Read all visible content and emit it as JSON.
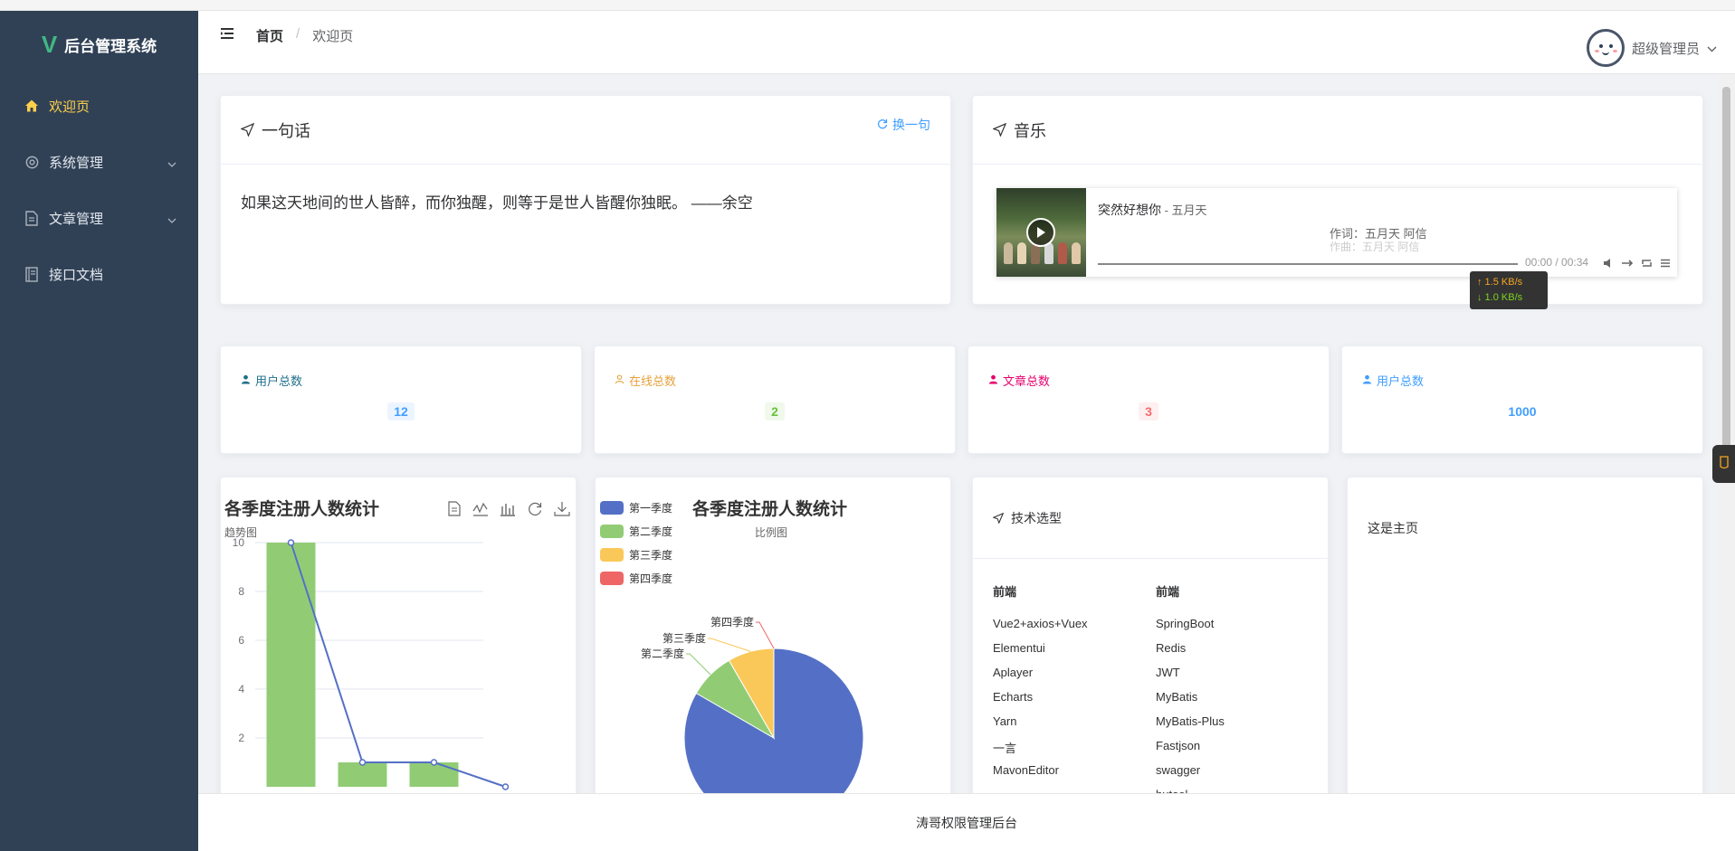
{
  "sidebar": {
    "logo": "V",
    "title": "后台管理系统",
    "items": [
      {
        "label": "欢迎页",
        "icon": "home-icon"
      },
      {
        "label": "系统管理",
        "icon": "gear-icon"
      },
      {
        "label": "文章管理",
        "icon": "document-icon"
      },
      {
        "label": "接口文档",
        "icon": "notebook-icon"
      }
    ]
  },
  "header": {
    "breadcrumb": [
      "首页",
      "欢迎页"
    ],
    "separator": "/",
    "user_name": "超级管理员"
  },
  "quote_card": {
    "title": "一句话",
    "refresh_label": "换一句",
    "text": "如果这天地间的世人皆醉，而你独醒，则等于是世人皆醒你独眠。 ——余空"
  },
  "music_card": {
    "title": "音乐",
    "song": "突然好想你",
    "artist": " - 五月天",
    "lyric_line1": "作词：五月天 阿信",
    "lyric_line2": "作曲：五月天 阿信",
    "time": "00:00 / 00:34",
    "upload_speed": "↑ 1.5 KB/s",
    "download_speed": "↓ 1.0 KB/s"
  },
  "stats": [
    {
      "label": "用户总数",
      "value": "12",
      "color": "#409eff",
      "bg": "#ecf5ff"
    },
    {
      "label": "在线总数",
      "value": "2",
      "color": "#67c23a",
      "bg": "#f0f9eb"
    },
    {
      "label": "文章总数",
      "value": "3",
      "color": "#f56c6c",
      "bg": "#fef0f0"
    },
    {
      "label": "用户总数",
      "value": "1000",
      "color": "#409eff",
      "bg": "transparent"
    }
  ],
  "stat_label_colors": [
    "#1f6f8b",
    "#e6a23c",
    "#e6006d",
    "#409eff"
  ],
  "chart_data": [
    {
      "type": "bar",
      "title": "各季度注册人数统计",
      "subtitle": "趋势图",
      "ylim": [
        0,
        10
      ],
      "yticks": [
        2,
        4,
        6,
        8,
        10
      ],
      "values": [
        10,
        1,
        1,
        0
      ],
      "line_values": [
        10,
        1,
        1,
        0
      ],
      "bar_color": "#91cc75",
      "line_color": "#5470c6",
      "toolbox": [
        "dataview-icon",
        "line-icon",
        "bar-icon",
        "restore-icon",
        "download-icon"
      ]
    },
    {
      "type": "pie",
      "title": "各季度注册人数统计",
      "subtitle": "比例图",
      "categories": [
        "第一季度",
        "第二季度",
        "第三季度",
        "第四季度"
      ],
      "values": [
        10,
        1,
        1,
        0
      ],
      "colors": [
        "#5470c6",
        "#91cc75",
        "#fac858",
        "#ee6666"
      ],
      "legend": "top-left"
    }
  ],
  "tech_card": {
    "title": "技术选型",
    "columns": [
      {
        "header": "前端",
        "items": [
          "Vue2+axios+Vuex",
          "Elementui",
          "Aplayer",
          "Echarts",
          "Yarn",
          "一言",
          "MavonEditor",
          "..."
        ]
      },
      {
        "header": "前端",
        "items": [
          "SpringBoot",
          "Redis",
          "JWT",
          "MyBatis",
          "MyBatis-Plus",
          "Fastjson",
          "swagger",
          "hutool"
        ]
      }
    ]
  },
  "home_card": {
    "text": "这是主页"
  },
  "footer": {
    "text": "涛哥权限管理后台"
  }
}
